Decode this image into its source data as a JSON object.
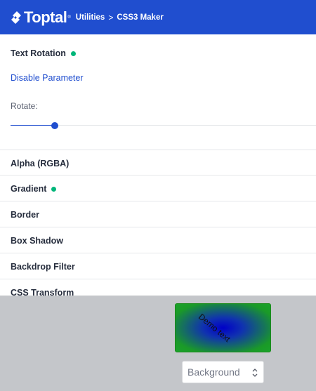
{
  "header": {
    "logo_text": "Toptal",
    "logo_reg": "®",
    "breadcrumbs": [
      "Utilities",
      "CSS3 Maker"
    ],
    "crumb_separator": ">"
  },
  "active_section": {
    "title": "Text Rotation",
    "status_dot": true,
    "disable_link": "Disable Parameter",
    "rotate_label": "Rotate:",
    "rotate_fraction": 0.145
  },
  "sections": [
    {
      "label": "Alpha (RGBA)",
      "dot": false
    },
    {
      "label": "Gradient",
      "dot": true
    },
    {
      "label": "Border",
      "dot": false
    },
    {
      "label": "Box Shadow",
      "dot": false
    },
    {
      "label": "Backdrop Filter",
      "dot": false
    },
    {
      "label": "CSS Transform",
      "dot": false
    }
  ],
  "preview": {
    "demo_text": "Demo text",
    "background_select": "Background"
  },
  "colors": {
    "brand": "#204ecf",
    "dot": "#00b67a",
    "preview_bg": "#c4c6ca"
  }
}
